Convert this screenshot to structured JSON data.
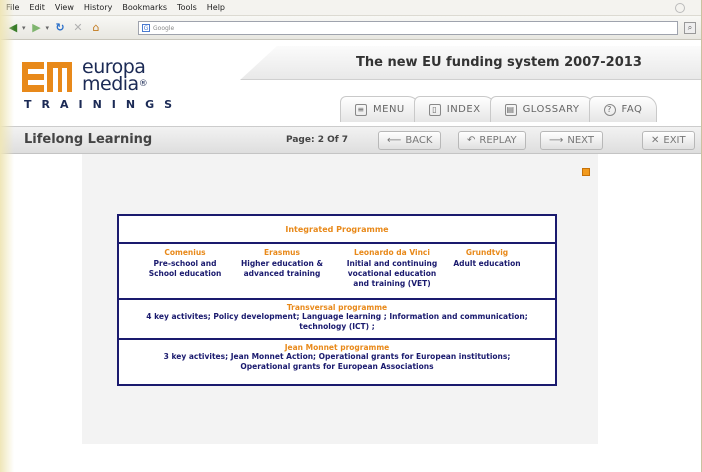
{
  "browser": {
    "menu": [
      "File",
      "Edit",
      "View",
      "History",
      "Bookmarks",
      "Tools",
      "Help"
    ],
    "search_placeholder": "Google"
  },
  "logo": {
    "line1": "europa",
    "line2": "media",
    "trademark": "®",
    "tagline": "TRAININGS"
  },
  "header": {
    "title": "The new EU funding system 2007-2013",
    "tabs": [
      "MENU",
      "INDEX",
      "GLOSSARY",
      "FAQ"
    ]
  },
  "toolbar": {
    "section": "Lifelong Learning",
    "page": "Page: 2 Of 7",
    "back": "BACK",
    "replay": "REPLAY",
    "next": "NEXT",
    "exit": "EXIT"
  },
  "diagram": {
    "header": "Integrated Programme",
    "programmes": [
      {
        "name": "Comenius",
        "desc": [
          "Pre-school and",
          "School education"
        ]
      },
      {
        "name": "Erasmus",
        "desc": [
          "Higher education &",
          "advanced training"
        ]
      },
      {
        "name": "Leonardo da Vinci",
        "desc": [
          "Initial and continuing",
          "vocational education",
          "and training (VET)"
        ]
      },
      {
        "name": "Grundtvig",
        "desc": [
          "Adult education"
        ]
      }
    ],
    "transversal": {
      "title": "Transversal programme",
      "line1": "4 key activites;  Policy development; Language learning ;  Information and communication;",
      "line2": "technology (ICT) ;"
    },
    "jean_monnet": {
      "title": "Jean Monnet programme",
      "line1": "3 key activites; Jean Monnet Action; Operational grants for European institutions;",
      "line2": "Operational grants for European Associations"
    }
  }
}
